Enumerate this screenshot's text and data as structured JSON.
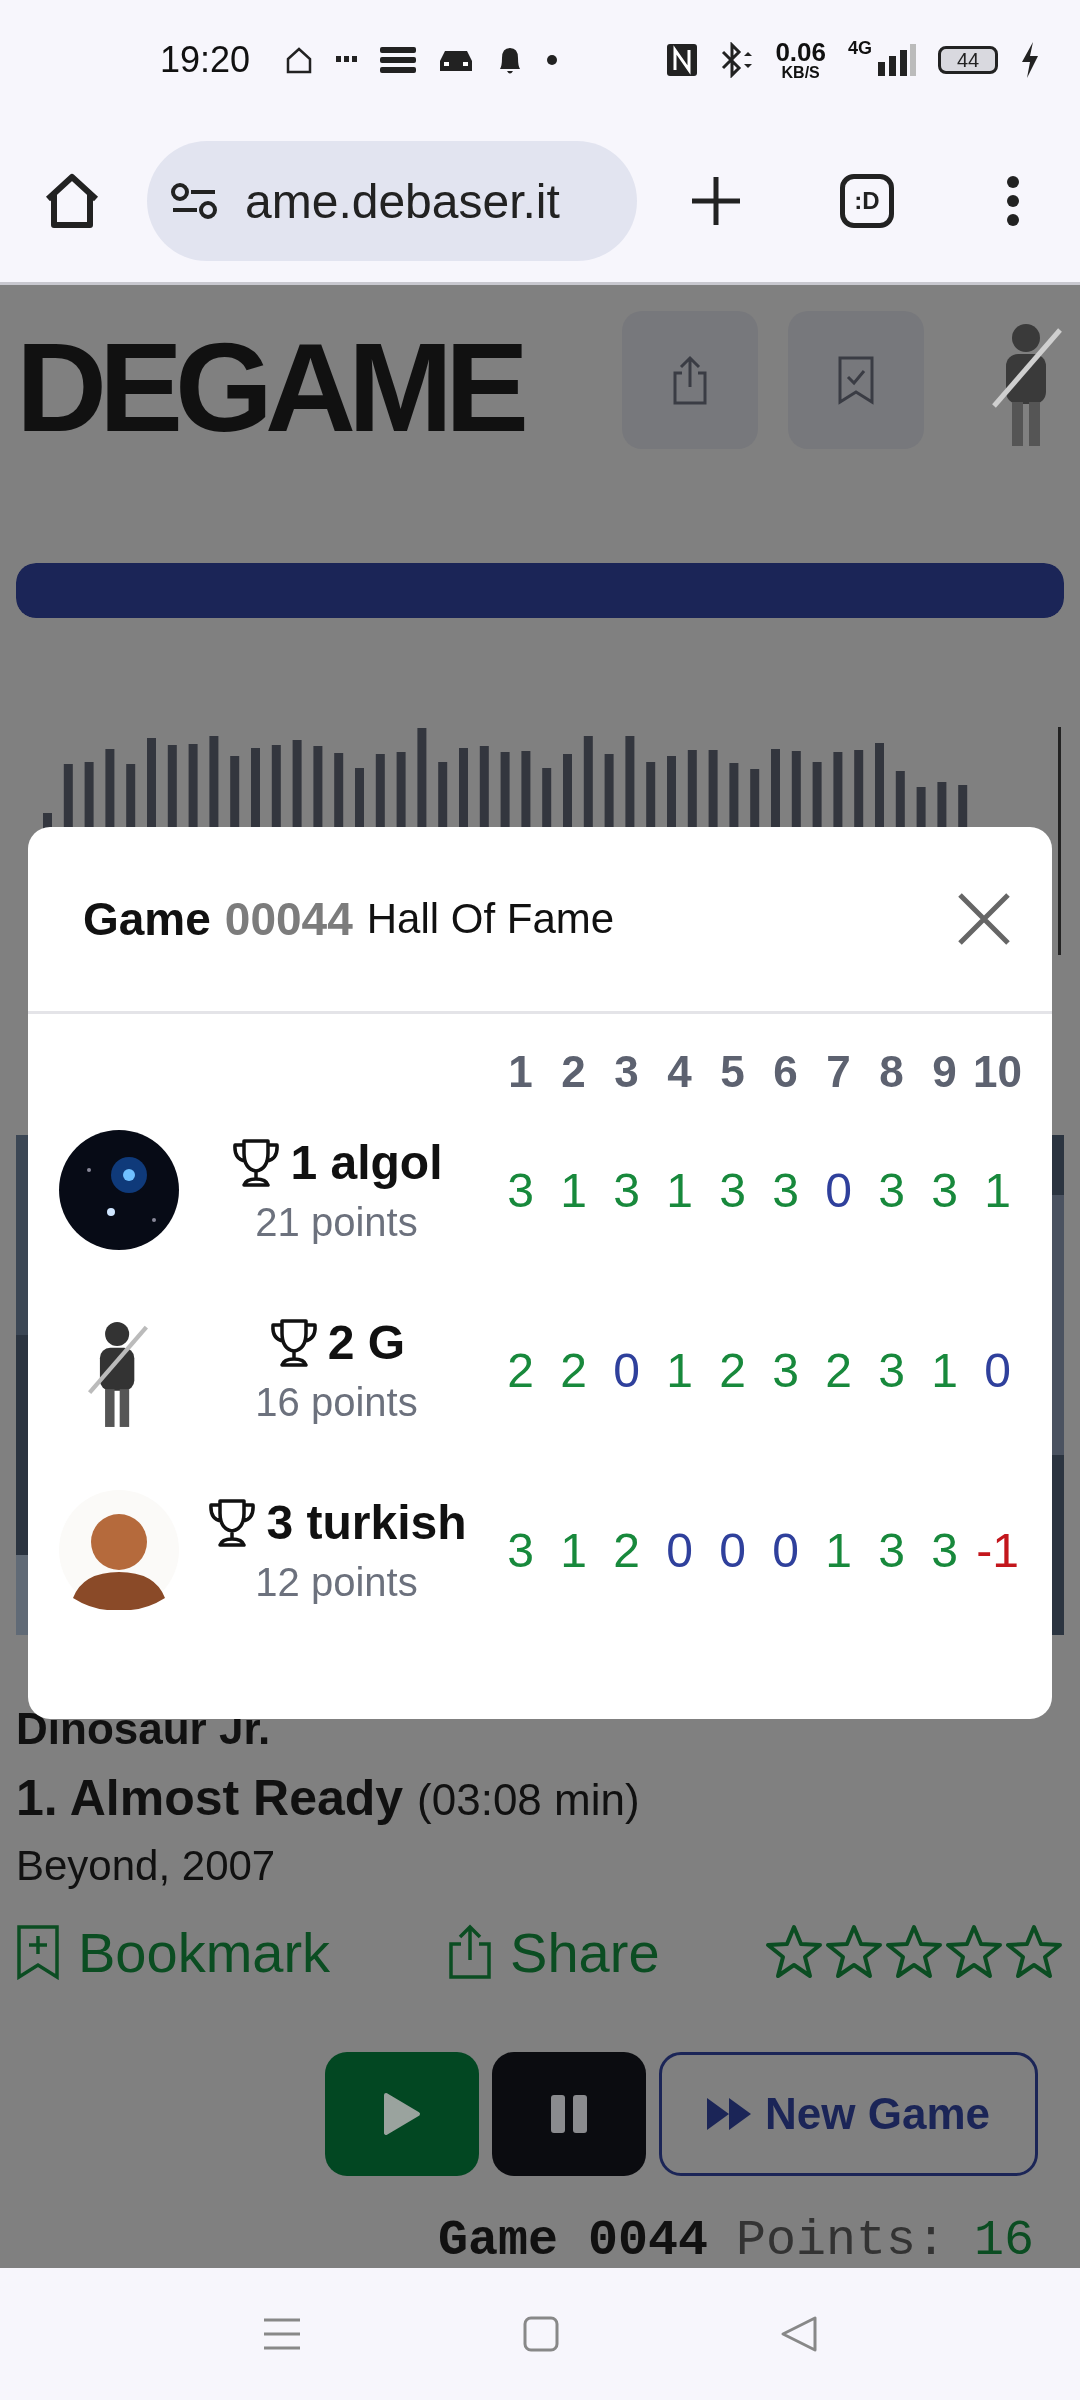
{
  "status_bar": {
    "time": "19:20",
    "net_speed": "0.06",
    "net_unit": "KB/S",
    "network": "4G",
    "battery": "44"
  },
  "browser": {
    "url": "ame.debaser.it",
    "tabs_label": ":D"
  },
  "header": {
    "logo": "DEGAME"
  },
  "progress": {
    "level": 1
  },
  "track": {
    "artist": "Dinosaur Jr.",
    "title": "1. Almost Ready",
    "duration": "(03:08 min)",
    "album": "Beyond, 2007"
  },
  "actions": [
    {
      "kind": "bookmark",
      "label": "Bookmark"
    },
    {
      "kind": "share",
      "label": "Share"
    }
  ],
  "rating": {
    "stars": 0
  },
  "controls": [
    {
      "kind": "play"
    },
    {
      "kind": "pause"
    },
    {
      "kind": "new_game",
      "label": "New Game"
    }
  ],
  "footer_line": {
    "game": "Game 0044",
    "points_label": "Points:",
    "points": "16"
  },
  "modal": {
    "title": "Game",
    "game_number": "00044",
    "subtitle": "Hall Of Fame",
    "columns": [
      "1",
      "2",
      "3",
      "4",
      "5",
      "6",
      "7",
      "8",
      "9",
      "10"
    ],
    "players": [
      {
        "rank": "1",
        "name": "algol",
        "points": "21 points",
        "scores": [
          {
            "value": "3",
            "color": "#18893c"
          },
          {
            "value": "1",
            "color": "#18893c"
          },
          {
            "value": "3",
            "color": "#18893c"
          },
          {
            "value": "1",
            "color": "#18893c"
          },
          {
            "value": "3",
            "color": "#18893c"
          },
          {
            "value": "3",
            "color": "#18893c"
          },
          {
            "value": "0",
            "color": "#2f409c"
          },
          {
            "value": "3",
            "color": "#18893c"
          },
          {
            "value": "3",
            "color": "#18893c"
          },
          {
            "value": "1",
            "color": "#18893c"
          }
        ]
      },
      {
        "rank": "2",
        "name": "G",
        "points": "16 points",
        "scores": [
          {
            "value": "2",
            "color": "#18893c"
          },
          {
            "value": "2",
            "color": "#18893c"
          },
          {
            "value": "0",
            "color": "#2f409c"
          },
          {
            "value": "1",
            "color": "#18893c"
          },
          {
            "value": "2",
            "color": "#18893c"
          },
          {
            "value": "3",
            "color": "#18893c"
          },
          {
            "value": "2",
            "color": "#18893c"
          },
          {
            "value": "3",
            "color": "#18893c"
          },
          {
            "value": "1",
            "color": "#18893c"
          },
          {
            "value": "0",
            "color": "#2f409c"
          }
        ]
      },
      {
        "rank": "3",
        "name": "turkish",
        "points": "12 points",
        "scores": [
          {
            "value": "3",
            "color": "#18893c"
          },
          {
            "value": "1",
            "color": "#18893c"
          },
          {
            "value": "2",
            "color": "#18893c"
          },
          {
            "value": "0",
            "color": "#2f409c"
          },
          {
            "value": "0",
            "color": "#2f409c"
          },
          {
            "value": "0",
            "color": "#2f409c"
          },
          {
            "value": "1",
            "color": "#18893c"
          },
          {
            "value": "3",
            "color": "#18893c"
          },
          {
            "value": "3",
            "color": "#18893c"
          },
          {
            "value": "-1",
            "color": "#c3161c"
          }
        ]
      }
    ]
  }
}
